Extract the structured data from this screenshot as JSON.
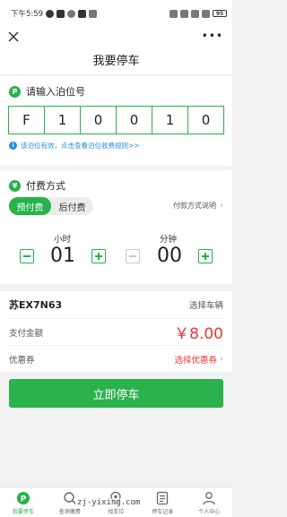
{
  "status_bar": {
    "time": "下午5:59",
    "battery": "95"
  },
  "page": {
    "title": "我要停车"
  },
  "berth": {
    "section_title": "请输入泊位号",
    "chars": [
      "F",
      "1",
      "0",
      "0",
      "1",
      "0"
    ],
    "notice": "该泊位有效，点击查看泊位收费规则>>"
  },
  "payment": {
    "section_title": "付费方式",
    "options": [
      "预付费",
      "后付费"
    ],
    "selected": "预付费",
    "method_note": "付款方式说明",
    "hours_label": "小时",
    "hours_value": "01",
    "minutes_label": "分钟",
    "minutes_value": "00"
  },
  "vehicle": {
    "plate": "苏EX7N63",
    "select_label": "选择车辆"
  },
  "amount": {
    "label": "支付金额",
    "value": "￥8.00"
  },
  "coupon": {
    "label": "优惠券",
    "action": "选择优惠券"
  },
  "actions": {
    "park_now": "立即停车"
  },
  "tabs": [
    {
      "label": "我要停车",
      "icon": "parking-icon",
      "active": true
    },
    {
      "label": "查询缴费",
      "icon": "search-icon",
      "active": false
    },
    {
      "label": "找车位",
      "icon": "location-icon",
      "active": false
    },
    {
      "label": "停车记录",
      "icon": "list-icon",
      "active": false
    },
    {
      "label": "个人中心",
      "icon": "person-icon",
      "active": false
    }
  ],
  "watermark": "zj-yixing.com",
  "colors": {
    "accent": "#2bb24c",
    "price": "#e53935",
    "link": "#2a8be0"
  }
}
